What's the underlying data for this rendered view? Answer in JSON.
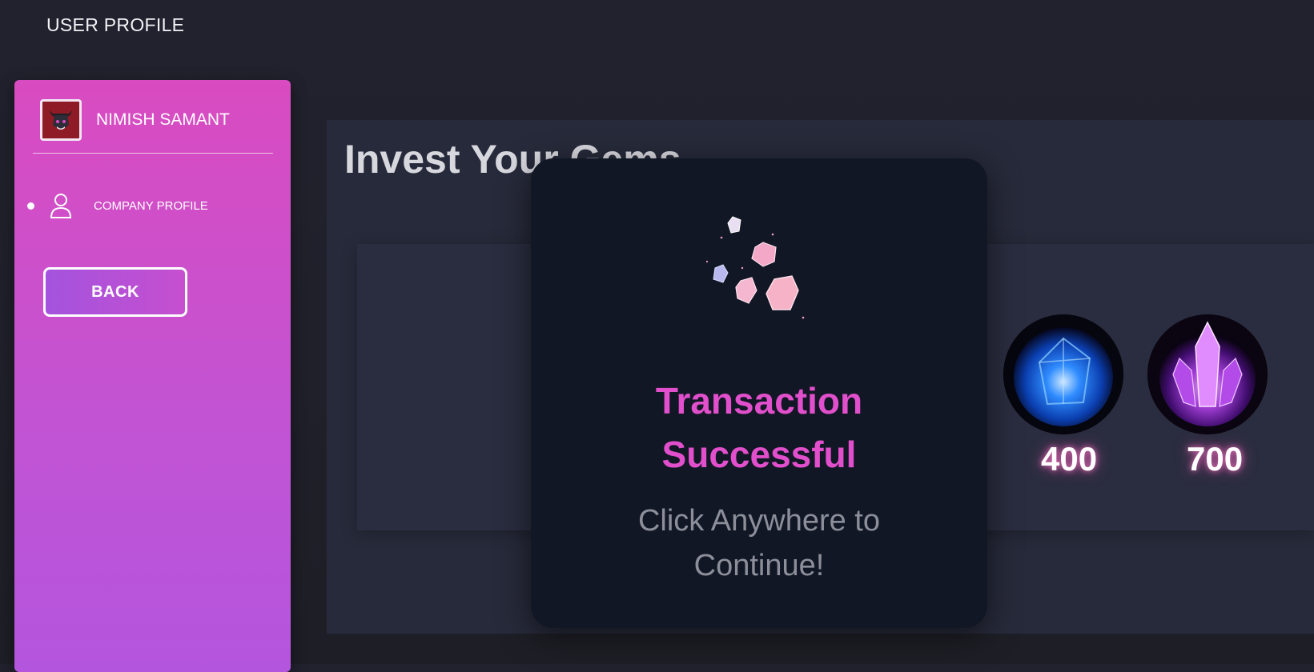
{
  "header": {
    "title": "USER PROFILE"
  },
  "sidebar": {
    "user_name": "NIMISH SAMANT",
    "nav_items": [
      {
        "label": "COMPANY PROFILE",
        "icon": "user-icon"
      }
    ],
    "back_label": "BACK"
  },
  "main": {
    "title": "Invest Your Gems",
    "gems": [
      {
        "price": "400",
        "icon": "blue-gem-icon"
      },
      {
        "price": "700",
        "icon": "purple-crystal-icon"
      }
    ]
  },
  "modal": {
    "heading_line1": "Transaction",
    "heading_line2": "Successful",
    "subtext_line1": "Click Anywhere to",
    "subtext_line2": "Continue!"
  },
  "colors": {
    "accent_pink": "#e24fcc",
    "sidebar_gradient_top": "#d94bc0",
    "sidebar_gradient_bottom": "#b455de",
    "background": "#1e1e26",
    "modal_bg": "#121725"
  }
}
